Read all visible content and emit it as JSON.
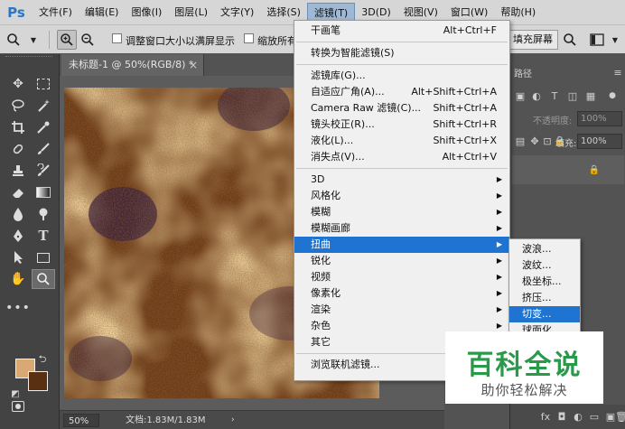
{
  "app": {
    "logo": "Ps"
  },
  "menubar": {
    "items": [
      {
        "label": "文件(F)",
        "active": false
      },
      {
        "label": "编辑(E)",
        "active": false
      },
      {
        "label": "图像(I)",
        "active": false
      },
      {
        "label": "图层(L)",
        "active": false
      },
      {
        "label": "文字(Y)",
        "active": false
      },
      {
        "label": "选择(S)",
        "active": false
      },
      {
        "label": "滤镜(T)",
        "active": true
      },
      {
        "label": "3D(D)",
        "active": false
      },
      {
        "label": "视图(V)",
        "active": false
      },
      {
        "label": "窗口(W)",
        "active": false
      },
      {
        "label": "帮助(H)",
        "active": false
      }
    ]
  },
  "options_bar": {
    "resize_windows_label": "调整窗口大小以满屏显示",
    "zoom_all_label": "缩放所有",
    "fill_screen_label": "填充屏幕"
  },
  "document": {
    "tab_title": "未标题-1 @ 50%(RGB/8) *",
    "zoom": "50%",
    "doc_size": "文档:1.83M/1.83M"
  },
  "right_panel": {
    "paths_tab": "路径",
    "opacity_label": "不透明度:",
    "opacity_value": "100%",
    "fill_label": "填充:",
    "fill_value": "100%"
  },
  "filter_menu": {
    "groups": [
      [
        {
          "label": "干画笔",
          "shortcut": "Alt+Ctrl+F"
        }
      ],
      [
        {
          "label": "转换为智能滤镜(S)",
          "shortcut": ""
        }
      ],
      [
        {
          "label": "滤镜库(G)...",
          "shortcut": ""
        },
        {
          "label": "自适应广角(A)...",
          "shortcut": "Alt+Shift+Ctrl+A"
        },
        {
          "label": "Camera Raw 滤镜(C)...",
          "shortcut": "Shift+Ctrl+A"
        },
        {
          "label": "镜头校正(R)...",
          "shortcut": "Shift+Ctrl+R"
        },
        {
          "label": "液化(L)...",
          "shortcut": "Shift+Ctrl+X"
        },
        {
          "label": "消失点(V)...",
          "shortcut": "Alt+Ctrl+V"
        }
      ],
      [
        {
          "label": "3D",
          "submenu": true
        },
        {
          "label": "风格化",
          "submenu": true
        },
        {
          "label": "模糊",
          "submenu": true
        },
        {
          "label": "模糊画廊",
          "submenu": true
        },
        {
          "label": "扭曲",
          "submenu": true,
          "highlighted": true
        },
        {
          "label": "锐化",
          "submenu": true
        },
        {
          "label": "视频",
          "submenu": true
        },
        {
          "label": "像素化",
          "submenu": true
        },
        {
          "label": "渲染",
          "submenu": true
        },
        {
          "label": "杂色",
          "submenu": true
        },
        {
          "label": "其它",
          "submenu": true
        }
      ],
      [
        {
          "label": "浏览联机滤镜...",
          "shortcut": ""
        }
      ]
    ]
  },
  "distort_submenu": {
    "items": [
      {
        "label": "波浪..."
      },
      {
        "label": "波纹..."
      },
      {
        "label": "极坐标..."
      },
      {
        "label": "挤压..."
      },
      {
        "label": "切变...",
        "highlighted": true
      },
      {
        "label": "球面化"
      }
    ]
  },
  "colors": {
    "foreground": "#d9a975",
    "background": "#5a3012",
    "menu_highlight": "#1f74d1"
  },
  "watermark": {
    "title": "百科全说",
    "subtitle": "助你轻松解决"
  }
}
